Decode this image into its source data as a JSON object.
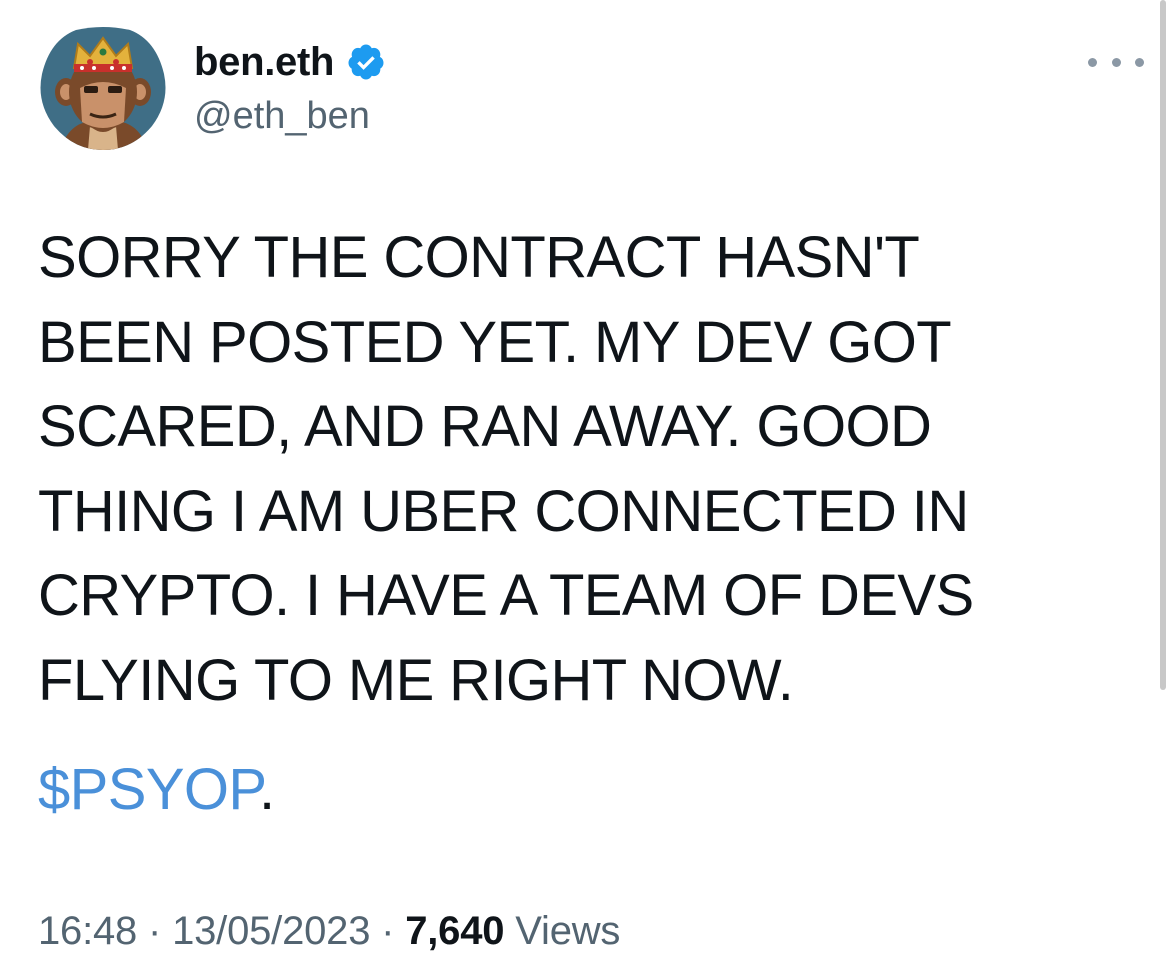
{
  "tweet": {
    "author": {
      "display_name": "ben.eth",
      "handle": "@eth_ben",
      "verified": true,
      "verified_badge_color": "#1d9bf0",
      "avatar_description_icon": "ape-avatar"
    },
    "more_menu_icon": "more-options-icon",
    "text": "SORRY THE CONTRACT HASN'T\nBEEN POSTED YET. MY DEV GOT\nSCARED, AND RAN AWAY. GOOD\nTHING I AM UBER CONNECTED IN\nCRYPTO. I HAVE A TEAM OF DEVS\nFLYING TO ME RIGHT NOW.",
    "cashtag": "$PSYOP",
    "cashtag_suffix": ".",
    "cashtag_color": "#4a90d9",
    "meta": {
      "time": "16:48",
      "separator": " · ",
      "date": "13/05/2023",
      "views_count": "7,640",
      "views_label": "Views"
    }
  }
}
